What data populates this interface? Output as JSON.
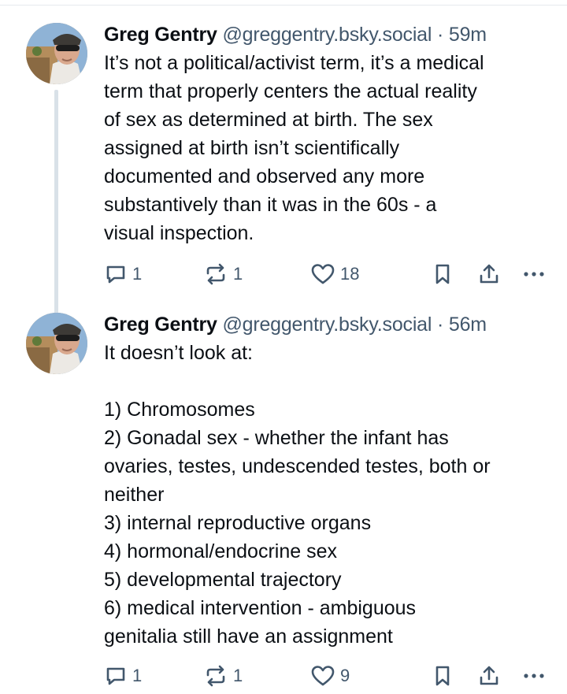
{
  "posts": [
    {
      "author_name": "Greg Gentry",
      "handle": "@greggentry.bsky.social",
      "separator": "·",
      "time": "59m",
      "text": "It’s not a political/activist term, it’s a medical\nterm that properly centers the actual reality\nof sex as determined at birth. The sex\nassigned at birth isn’t scientifically\ndocumented and observed any more\nsubstantively than it was in the 60s - a\nvisual inspection.",
      "reply_count": "1",
      "repost_count": "1",
      "like_count": "18"
    },
    {
      "author_name": "Greg Gentry",
      "handle": "@greggentry.bsky.social",
      "separator": "·",
      "time": "56m",
      "text": "It doesn’t look at:\n\n1) Chromosomes\n2) Gonadal sex - whether the infant has\novaries, testes, undescended testes, both or\nneither\n3) internal reproductive organs\n4) hormonal/endocrine sex\n5) developmental trajectory\n6) medical intervention - ambiguous\ngenitalia still have an assignment",
      "reply_count": "1",
      "repost_count": "1",
      "like_count": "9"
    }
  ],
  "icons": {
    "reply": "reply-bubble-icon",
    "repost": "repost-arrows-icon",
    "like": "heart-icon",
    "bookmark": "bookmark-icon",
    "share": "share-upload-icon",
    "more": "more-dots-icon"
  },
  "colors": {
    "text": "#0b0f14",
    "secondary": "#42576c",
    "thread_line": "#d9e1e8"
  }
}
